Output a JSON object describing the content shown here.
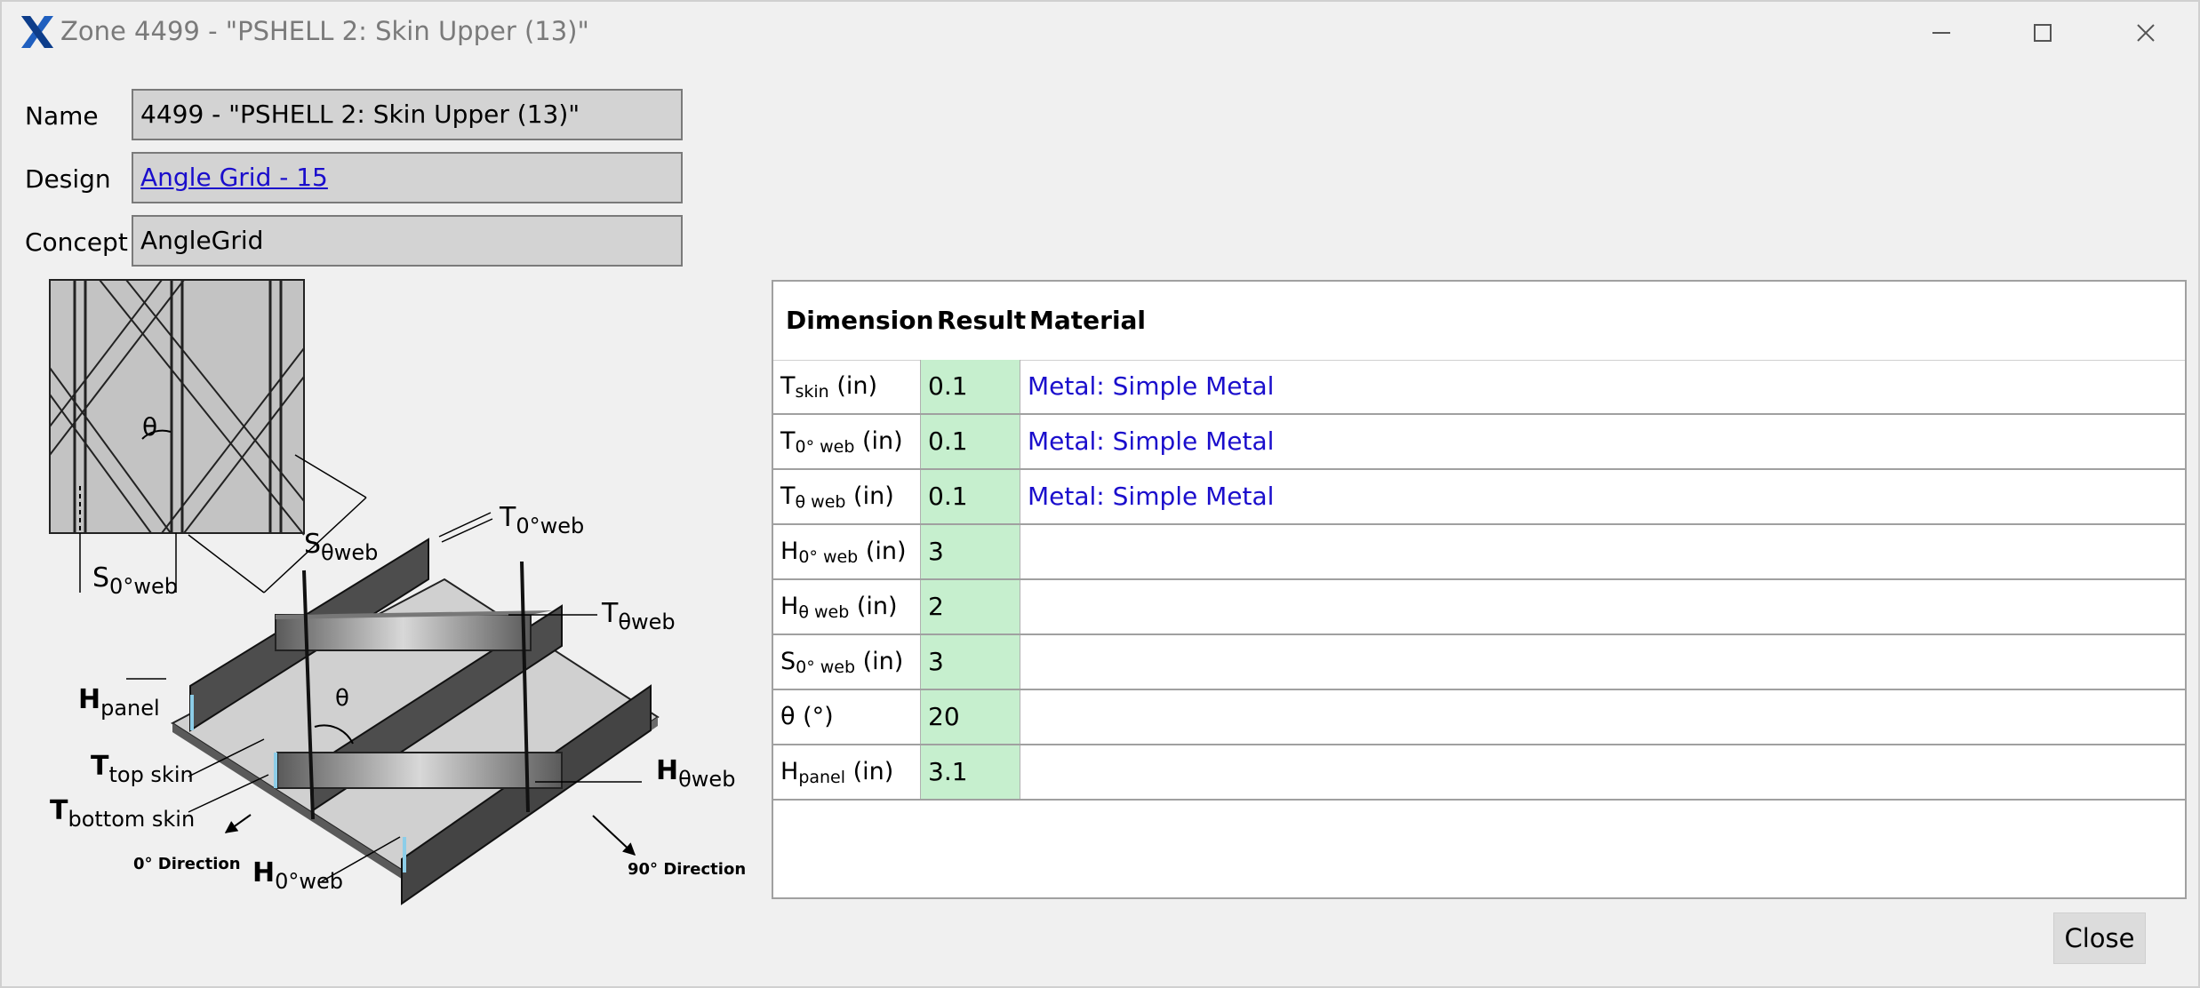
{
  "window": {
    "title": "Zone 4499 - \"PSHELL 2: Skin Upper (13)\"",
    "brand_color": "#1f5fbf"
  },
  "form": {
    "name_label": "Name",
    "name_value": "4499 - \"PSHELL 2: Skin Upper (13)\"",
    "design_label": "Design",
    "design_value": "Angle Grid - 15",
    "concept_label": "Concept",
    "concept_value": "AngleGrid"
  },
  "diagram": {
    "labels": {
      "theta": "θ",
      "s_theta_web": [
        "S",
        "θweb"
      ],
      "s_0_web": [
        "S",
        "0°web"
      ],
      "t_0_web": [
        "T",
        "0°web"
      ],
      "t_theta_web": [
        "T",
        "θweb"
      ],
      "h_panel": [
        "H",
        "panel"
      ],
      "t_top_skin": [
        "T",
        "top skin"
      ],
      "t_bottom_skin": [
        "T",
        "bottom skin"
      ],
      "h_theta_web": [
        "H",
        "θweb"
      ],
      "h_0_web": [
        "H",
        "0°web"
      ],
      "dir_0": "0° Direction",
      "dir_90": "90° Direction"
    }
  },
  "table": {
    "headers": {
      "dimension": "Dimension",
      "result": "Result",
      "material": "Material"
    },
    "rows": [
      {
        "base": "T",
        "sub": "skin",
        "unit": " (in)",
        "result": "0.1",
        "material": "Metal: Simple Metal"
      },
      {
        "base": "T",
        "sub": "0° web",
        "unit": " (in)",
        "result": "0.1",
        "material": "Metal: Simple Metal"
      },
      {
        "base": "T",
        "sub": "θ web",
        "unit": " (in)",
        "result": "0.1",
        "material": "Metal: Simple Metal"
      },
      {
        "base": "H",
        "sub": "0° web",
        "unit": " (in)",
        "result": "3",
        "material": ""
      },
      {
        "base": "H",
        "sub": "θ web",
        "unit": " (in)",
        "result": "2",
        "material": ""
      },
      {
        "base": "S",
        "sub": "0° web",
        "unit": " (in)",
        "result": "3",
        "material": ""
      },
      {
        "base": "θ",
        "sub": "",
        "unit": " (°)",
        "result": "20",
        "material": ""
      },
      {
        "base": "H",
        "sub": "panel",
        "unit": " (in)",
        "result": "3.1",
        "material": ""
      }
    ]
  },
  "footer": {
    "close_label": "Close"
  }
}
